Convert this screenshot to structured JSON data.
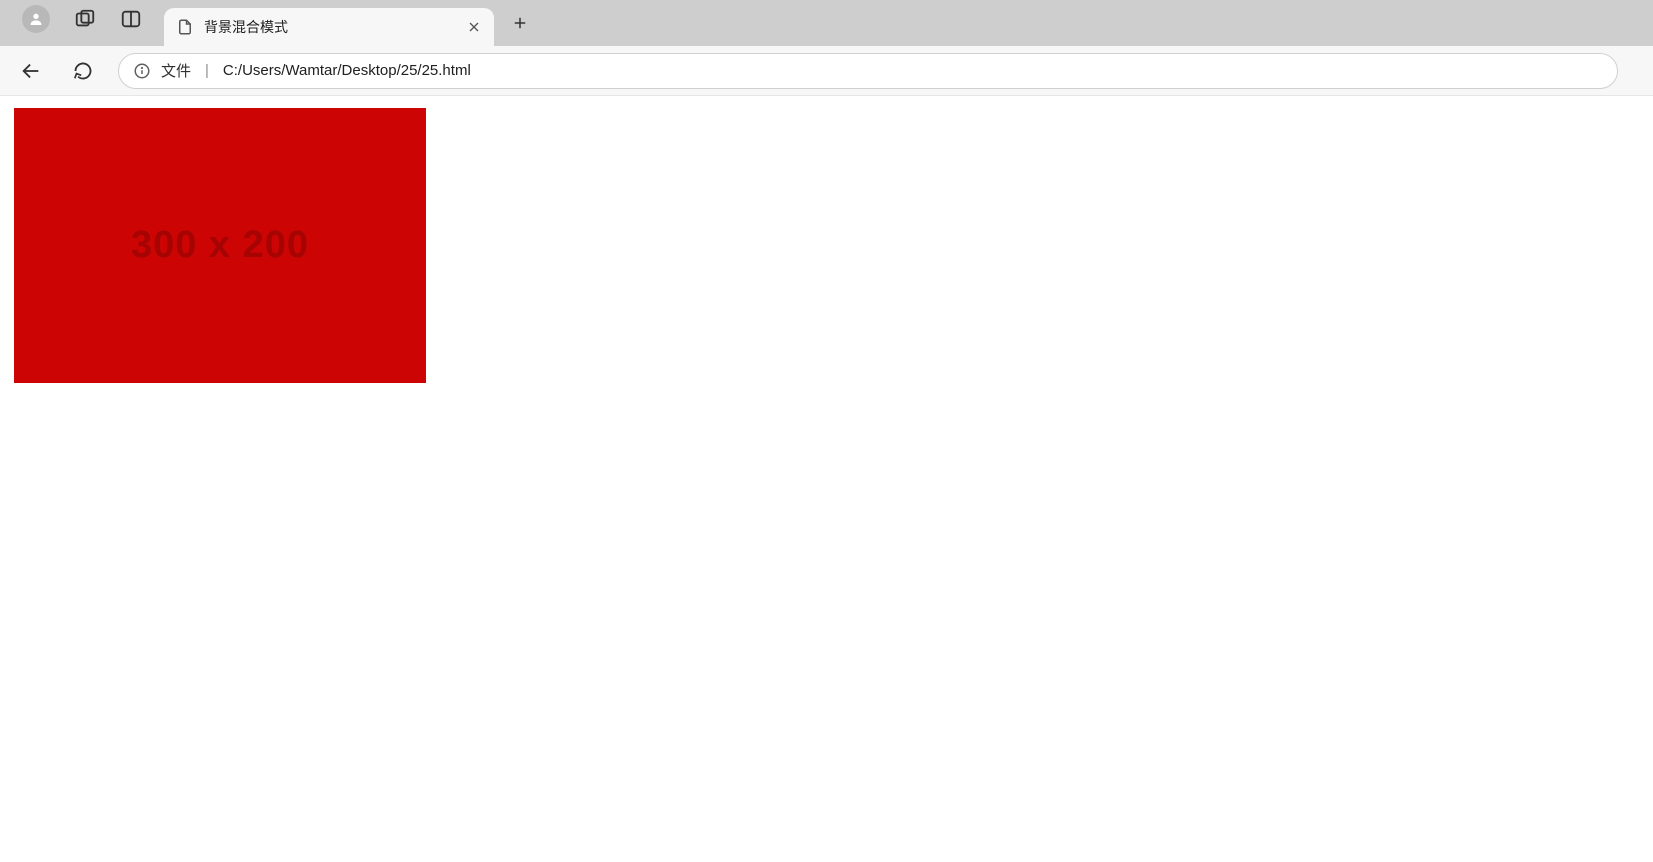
{
  "browser": {
    "tab": {
      "title": "背景混合模式"
    },
    "address": {
      "scheme_label": "文件",
      "separator": "|",
      "url": "C:/Users/Wamtar/Desktop/25/25.html"
    }
  },
  "page": {
    "placeholder_text": "300 x 200",
    "box_color": "#cc0404"
  }
}
